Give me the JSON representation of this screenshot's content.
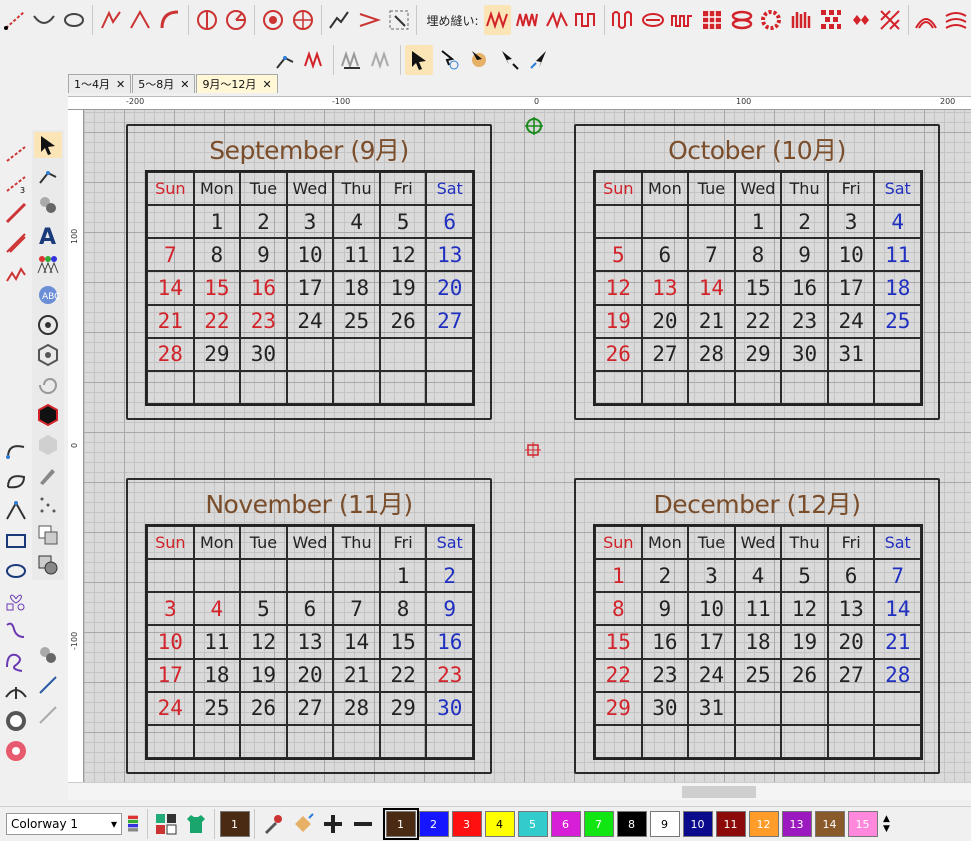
{
  "colors": {
    "canvas": "#dadada",
    "active_tab": "#fff7d6",
    "weekend_red": "#d3232a",
    "weekend_blue": "#1f2fbf",
    "title_brown": "#7a4d2b"
  },
  "toolbar": {
    "embroidery_label": "埋め縫い:"
  },
  "tabs": [
    {
      "label": "1〜4月",
      "close": "✕"
    },
    {
      "label": "5〜8月",
      "close": "✕"
    },
    {
      "label": "9月〜12月",
      "close": "✕",
      "active": true
    }
  ],
  "rulers": {
    "top": [
      "-200",
      "-100",
      "0",
      "100",
      "200"
    ],
    "left": [
      "100",
      "0",
      "-100"
    ]
  },
  "weekdays": [
    "Sun",
    "Mon",
    "Tue",
    "Wed",
    "Thu",
    "Fri",
    "Sat"
  ],
  "calendars": [
    {
      "title": "September (9月)",
      "start": 1,
      "days": 30,
      "red": [
        15,
        16,
        22,
        23
      ]
    },
    {
      "title": "October (10月)",
      "start": 3,
      "days": 31,
      "red": [
        13,
        14
      ]
    },
    {
      "title": "November (11月)",
      "start": 5,
      "days": 30,
      "red": [
        3,
        4,
        23
      ]
    },
    {
      "title": "December (12月)",
      "start": 0,
      "days": 31,
      "red": []
    }
  ],
  "bottom": {
    "colorway": "Colorway 1",
    "current_thread": "1",
    "swatches": [
      {
        "num": "1",
        "color": "#4a2a12",
        "text": "#fff"
      },
      {
        "num": "2",
        "color": "#1515ff",
        "text": "#fff"
      },
      {
        "num": "3",
        "color": "#ff1010",
        "text": "#fff"
      },
      {
        "num": "4",
        "color": "#ffff00",
        "text": "#000"
      },
      {
        "num": "5",
        "color": "#33cccc",
        "text": "#fff"
      },
      {
        "num": "6",
        "color": "#d81fd8",
        "text": "#fff"
      },
      {
        "num": "7",
        "color": "#12e612",
        "text": "#fff"
      },
      {
        "num": "8",
        "color": "#000000",
        "text": "#fff"
      },
      {
        "num": "9",
        "color": "#ffffff",
        "text": "#000"
      },
      {
        "num": "10",
        "color": "#0a0a8c",
        "text": "#fff"
      },
      {
        "num": "11",
        "color": "#8c0a0a",
        "text": "#fff"
      },
      {
        "num": "12",
        "color": "#ff9c2a",
        "text": "#fff"
      },
      {
        "num": "13",
        "color": "#9a1abf",
        "text": "#fff"
      },
      {
        "num": "14",
        "color": "#8a5a2b",
        "text": "#fff"
      },
      {
        "num": "15",
        "color": "#ff88dd",
        "text": "#fff"
      }
    ]
  }
}
